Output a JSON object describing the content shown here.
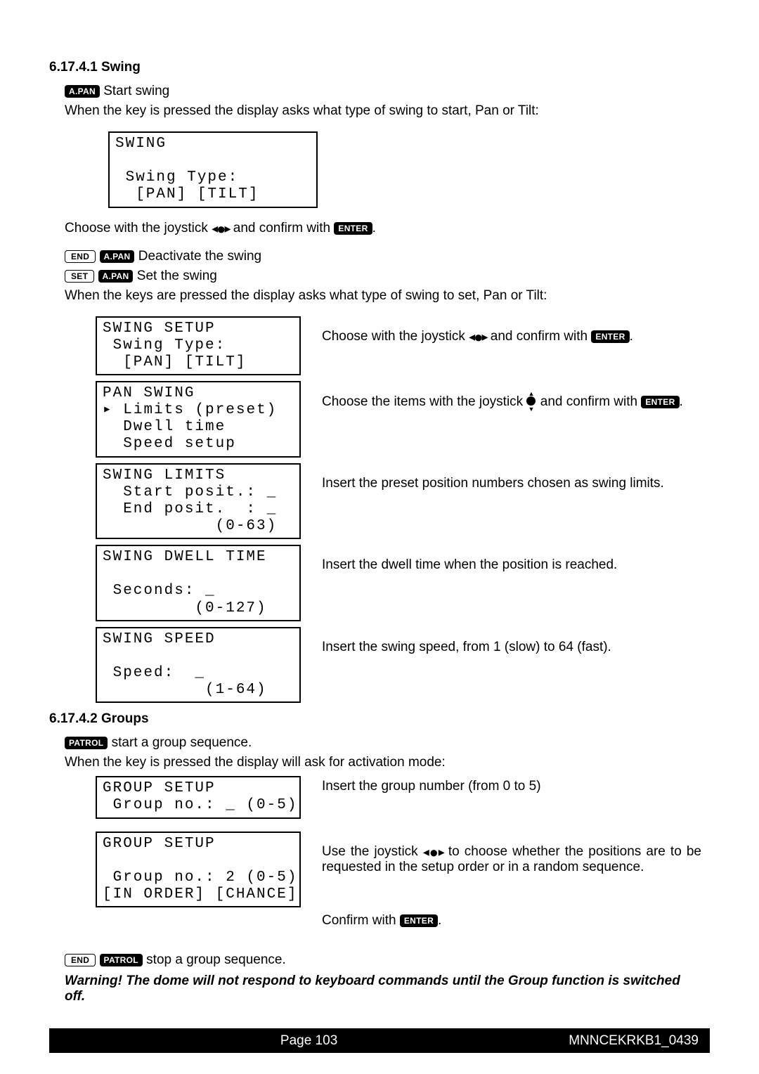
{
  "sections": {
    "swing": {
      "number": "6.17.4.1 Swing",
      "start_text": "Start swing",
      "when_press_text": "When the key is pressed the display asks what type of swing to start, Pan or Tilt:",
      "choose_text_pre": "Choose with the joystick ",
      "choose_text_mid": " and confirm with ",
      "deactivate_text": "Deactivate the swing",
      "set_text": "Set the swing",
      "when_keys_text": "When the keys are pressed the display asks what type of swing to set, Pan or Tilt:"
    },
    "groups": {
      "number": "6.17.4.2 Groups",
      "start_text": "start a group sequence.",
      "when_press_text": "When the key is pressed the display will ask for activation mode:",
      "stop_text": "stop a group sequence."
    }
  },
  "buttons": {
    "apan": "A.PAN",
    "enter": "ENTER",
    "end": "END",
    "set": "SET",
    "patrol": "PATROL"
  },
  "lcd": {
    "swing": "SWING\n\n Swing Type:\n  [PAN] [TILT]",
    "swing_setup": "SWING SETUP\n Swing Type:\n  [PAN] [TILT]",
    "pan_swing": "PAN SWING\n▸ Limits (preset)\n  Dwell time\n  Speed setup",
    "swing_limits": "SWING LIMITS\n  Start posit.: _\n  End posit.  : _\n           (0-63)",
    "swing_dwell": "SWING DWELL TIME\n\n Seconds: _\n         (0-127)",
    "swing_speed": "SWING SPEED\n\n Speed:  _\n          (1-64)",
    "group_setup1": "GROUP SETUP\n Group no.: _ (0-5)\n",
    "group_setup2": "GROUP SETUP\n\n Group no.: 2 (0-5)\n[IN ORDER] [CHANCE]"
  },
  "descriptions": {
    "swing_setup_desc_pre": "Choose with the joystick ",
    "swing_setup_desc_mid": " and confirm with ",
    "pan_swing_desc_pre": "Choose the items with the joystick ",
    "pan_swing_desc_mid": " and confirm with ",
    "swing_limits_desc": "Insert the preset position numbers chosen as swing limits.",
    "swing_dwell_desc": "Insert the dwell time when the position is reached.",
    "swing_speed_desc": "Insert the swing speed, from 1 (slow) to 64 (fast).",
    "group_setup1_desc": "Insert the group number (from 0 to 5)",
    "group_setup2_desc_pre": "Use the joystick ",
    "group_setup2_desc_post": " to choose whether the positions are to be requested in the setup order or in a random sequence.",
    "confirm_pre": "Confirm with "
  },
  "warning": "Warning! The dome will not respond to keyboard commands until the Group function is switched off.",
  "footer": {
    "page": "Page 103",
    "doc": "MNNCEKRKB1_0439"
  }
}
